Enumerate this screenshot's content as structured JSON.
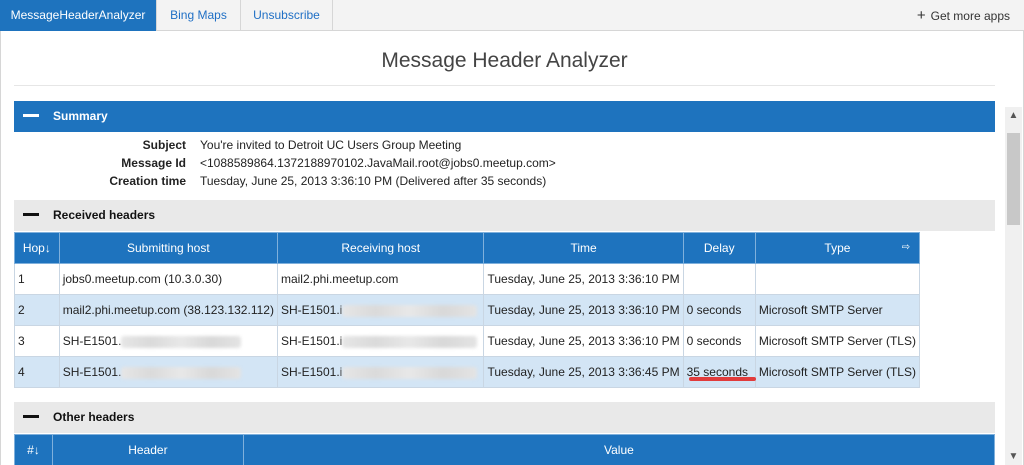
{
  "tabs": [
    {
      "label": "MessageHeaderAnalyzer",
      "active": true
    },
    {
      "label": "Bing Maps",
      "active": false
    },
    {
      "label": "Unsubscribe",
      "active": false
    }
  ],
  "get_more": {
    "icon": "plus-icon",
    "label": "Get more apps"
  },
  "title": "Message Header Analyzer",
  "summary": {
    "header": "Summary",
    "rows": [
      {
        "key": "Subject",
        "value": "You're invited to Detroit UC Users Group Meeting"
      },
      {
        "key": "Message Id",
        "value": "<1088589864.1372188970102.JavaMail.root@jobs0.meetup.com>"
      },
      {
        "key": "Creation time",
        "value": "Tuesday, June 25, 2013 3:36:10 PM (Delivered after 35 seconds)"
      }
    ]
  },
  "received": {
    "header": "Received headers",
    "columns": [
      "Hop↓",
      "Submitting host",
      "Receiving host",
      "Time",
      "Delay",
      "Type"
    ],
    "type_column_icon": "arrow-right-icon",
    "rows": [
      {
        "hop": "1",
        "submitting": "jobs0.meetup.com (10.3.0.30)",
        "receiving": "mail2.phi.meetup.com",
        "time": "Tuesday, June 25, 2013 3:36:10 PM",
        "delay": "",
        "type": ""
      },
      {
        "hop": "2",
        "submitting": "mail2.phi.meetup.com (38.123.132.112)",
        "receiving": "SH-E1501.i",
        "time": "Tuesday, June 25, 2013 3:36:10 PM",
        "delay": "0 seconds",
        "type": "Microsoft SMTP Server"
      },
      {
        "hop": "3",
        "submitting": "SH-E1501.",
        "receiving": "SH-E1501.i",
        "time": "Tuesday, June 25, 2013 3:36:10 PM",
        "delay": "0 seconds",
        "type": "Microsoft SMTP Server (TLS)"
      },
      {
        "hop": "4",
        "submitting": "SH-E1501.",
        "receiving": "SH-E1501.i",
        "time": "Tuesday, June 25, 2013 3:36:45 PM",
        "delay": "35 seconds",
        "type": "Microsoft SMTP Server (TLS)"
      }
    ]
  },
  "other": {
    "header": "Other headers",
    "columns": [
      "#↓",
      "Header",
      "Value"
    ]
  },
  "colors": {
    "accent": "#1e73be",
    "row_alt": "#d3e5f5",
    "highlight": "#e13b3b"
  }
}
